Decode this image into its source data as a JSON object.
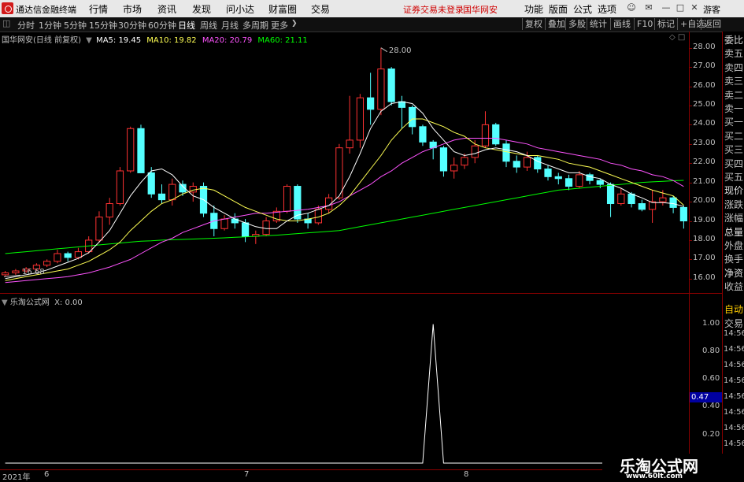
{
  "titlebar": {
    "app_name": "通达信金融终端",
    "menus": [
      "行情",
      "市场",
      "资讯",
      "发现",
      "问小达",
      "财富圈",
      "交易"
    ],
    "login_status": "证券交易未登录",
    "stock_name": "国华网安",
    "right_menus": [
      "功能",
      "版面",
      "公式",
      "选项"
    ],
    "guest": "游客"
  },
  "tabs": [
    "分时",
    "1分钟",
    "5分钟",
    "15分钟",
    "30分钟",
    "60分钟",
    "日线",
    "周线",
    "月线",
    "多周期",
    "更多"
  ],
  "tab_active": "日线",
  "right_buttons": [
    "复权",
    "叠加",
    "多股",
    "统计",
    "画线",
    "F10",
    "标记",
    "+自选",
    "返回"
  ],
  "main_legend": {
    "title": "国华网安(日线 前复权)",
    "ma5": "MA5: 19.45",
    "ma10": "MA10: 19.82",
    "ma20": "MA20: 20.79",
    "ma60": "MA60: 21.11"
  },
  "indicator_legend": {
    "title": "乐淘公式网",
    "x_value": "X: 0.00"
  },
  "high_label": "28.00",
  "low_label": "16.68",
  "price_axis": [
    "28.00",
    "27.00",
    "26.00",
    "25.00",
    "24.00",
    "23.00",
    "22.00",
    "21.00",
    "20.00",
    "19.00",
    "18.00",
    "17.00",
    "16.00"
  ],
  "ind_axis": [
    "1.00",
    "0.80",
    "0.60",
    "0.40",
    "0.20"
  ],
  "ind_axis_highlight": "0.47",
  "right_panel_top": [
    "委比",
    "卖五",
    "卖四",
    "卖三",
    "卖二",
    "卖一",
    "买一",
    "买二",
    "买三",
    "买四",
    "买五",
    "现价",
    "涨跌",
    "涨幅",
    "总量",
    "外盘",
    "换手",
    "净资",
    "收益"
  ],
  "right_panel_bottom": [
    "自动",
    "交易",
    "14:56",
    "14:56",
    "14:56",
    "14:56",
    "14:56",
    "14:56",
    "14:56",
    "14:56",
    "14:56"
  ],
  "date_labels": [
    "2021年",
    "6",
    "7",
    "8"
  ],
  "watermark": {
    "cn": "乐淘公式网",
    "url": "www.60lt.com"
  },
  "colors": {
    "up": "#ff3232",
    "down": "#54ffff",
    "ma5": "#ffffff",
    "ma10": "#ffff54",
    "ma20": "#ff54ff",
    "ma60": "#00ff00",
    "border": "#8b0000"
  },
  "chart_data": {
    "type": "candlestick",
    "dates_start": "2021-05",
    "ohlc": [
      [
        16.2,
        16.4,
        16.1,
        16.3
      ],
      [
        16.3,
        16.5,
        16.2,
        16.4
      ],
      [
        16.4,
        16.6,
        16.3,
        16.5
      ],
      [
        16.5,
        16.8,
        16.4,
        16.7
      ],
      [
        16.7,
        17.0,
        16.6,
        16.9
      ],
      [
        16.9,
        17.5,
        16.8,
        17.3
      ],
      [
        17.3,
        17.4,
        16.9,
        17.1
      ],
      [
        17.1,
        17.6,
        17.0,
        17.4
      ],
      [
        17.4,
        18.2,
        17.3,
        18.0
      ],
      [
        18.0,
        19.5,
        17.9,
        19.2
      ],
      [
        19.2,
        20.2,
        18.8,
        19.9
      ],
      [
        19.9,
        21.8,
        19.8,
        21.6
      ],
      [
        21.6,
        23.9,
        21.5,
        23.8
      ],
      [
        23.8,
        24.0,
        21.5,
        21.5
      ],
      [
        21.5,
        21.8,
        20.2,
        20.4
      ],
      [
        20.4,
        20.9,
        19.9,
        20.1
      ],
      [
        20.1,
        21.2,
        19.8,
        20.9
      ],
      [
        20.9,
        21.1,
        20.3,
        20.5
      ],
      [
        20.5,
        21.0,
        20.0,
        20.8
      ],
      [
        20.8,
        21.0,
        19.2,
        19.4
      ],
      [
        19.4,
        19.8,
        18.2,
        18.6
      ],
      [
        18.6,
        19.3,
        18.5,
        19.1
      ],
      [
        19.1,
        19.4,
        18.6,
        18.9
      ],
      [
        18.9,
        19.1,
        17.9,
        18.2
      ],
      [
        18.2,
        18.5,
        17.8,
        18.3
      ],
      [
        18.3,
        19.2,
        18.2,
        19.0
      ],
      [
        19.0,
        19.7,
        18.9,
        19.5
      ],
      [
        19.5,
        20.9,
        19.4,
        20.8
      ],
      [
        20.8,
        20.9,
        18.9,
        19.1
      ],
      [
        19.1,
        19.4,
        18.6,
        18.9
      ],
      [
        18.9,
        19.8,
        18.8,
        19.6
      ],
      [
        19.6,
        20.4,
        19.4,
        20.2
      ],
      [
        20.2,
        23.0,
        20.1,
        22.8
      ],
      [
        22.8,
        25.5,
        22.5,
        23.2
      ],
      [
        23.2,
        25.6,
        22.8,
        25.4
      ],
      [
        25.4,
        26.7,
        24.0,
        24.8
      ],
      [
        24.8,
        28.0,
        24.5,
        26.9
      ],
      [
        26.9,
        27.0,
        25.0,
        25.2
      ],
      [
        25.2,
        25.5,
        23.8,
        24.9
      ],
      [
        24.9,
        25.0,
        23.5,
        23.9
      ],
      [
        23.9,
        24.0,
        22.9,
        23.1
      ],
      [
        23.1,
        23.2,
        22.2,
        22.8
      ],
      [
        22.8,
        22.9,
        21.3,
        21.6
      ],
      [
        21.6,
        22.3,
        21.2,
        21.9
      ],
      [
        21.9,
        22.5,
        21.7,
        22.3
      ],
      [
        22.3,
        23.2,
        22.0,
        22.9
      ],
      [
        22.9,
        24.7,
        22.8,
        24.0
      ],
      [
        24.0,
        24.1,
        22.9,
        23.0
      ],
      [
        23.0,
        23.2,
        21.8,
        22.1
      ],
      [
        22.1,
        22.4,
        21.5,
        21.8
      ],
      [
        21.8,
        22.6,
        21.6,
        22.3
      ],
      [
        22.3,
        22.4,
        21.5,
        21.7
      ],
      [
        21.7,
        21.9,
        21.1,
        21.3
      ],
      [
        21.3,
        21.5,
        20.9,
        21.2
      ],
      [
        21.2,
        21.4,
        20.6,
        20.8
      ],
      [
        20.8,
        21.6,
        20.7,
        21.4
      ],
      [
        21.4,
        21.5,
        20.9,
        21.1
      ],
      [
        21.1,
        21.2,
        20.7,
        20.9
      ],
      [
        20.9,
        21.0,
        19.2,
        19.9
      ],
      [
        19.9,
        20.7,
        19.8,
        20.4
      ],
      [
        20.4,
        20.5,
        19.7,
        19.9
      ],
      [
        19.9,
        20.1,
        19.5,
        19.6
      ],
      [
        19.6,
        20.6,
        18.9,
        20.0
      ],
      [
        20.0,
        20.6,
        19.8,
        20.2
      ],
      [
        20.2,
        20.3,
        19.4,
        19.7
      ],
      [
        19.7,
        19.8,
        18.6,
        19.0
      ]
    ],
    "ma5": [
      16.0,
      16.1,
      16.2,
      16.3,
      16.45,
      16.65,
      16.85,
      17.05,
      17.35,
      17.9,
      18.5,
      19.4,
      20.3,
      21.0,
      21.6,
      21.7,
      21.4,
      20.8,
      20.3,
      20.1,
      19.7,
      19.4,
      19.1,
      18.9,
      18.7,
      18.6,
      18.6,
      19.0,
      19.3,
      19.4,
      19.6,
      19.8,
      20.3,
      21.3,
      22.5,
      23.8,
      24.7,
      25.1,
      25.2,
      25.1,
      24.6,
      23.8,
      23.2,
      22.6,
      22.4,
      22.5,
      22.7,
      22.8,
      22.7,
      22.6,
      22.4,
      22.1,
      21.9,
      21.7,
      21.5,
      21.5,
      21.3,
      21.2,
      20.9,
      20.7,
      20.4,
      20.2,
      19.95,
      19.95,
      19.9,
      19.75
    ],
    "ma10": [
      15.9,
      16.0,
      16.1,
      16.2,
      16.3,
      16.4,
      16.5,
      16.7,
      16.9,
      17.2,
      17.5,
      17.9,
      18.5,
      19.0,
      19.5,
      19.9,
      20.1,
      20.4,
      20.6,
      20.7,
      20.6,
      20.3,
      20.0,
      19.7,
      19.5,
      19.3,
      19.1,
      19.0,
      19.0,
      19.1,
      19.2,
      19.4,
      19.8,
      20.3,
      21.0,
      21.7,
      22.4,
      23.2,
      23.8,
      24.3,
      24.3,
      24.1,
      23.9,
      23.6,
      23.4,
      23.0,
      22.8,
      22.7,
      22.6,
      22.5,
      22.4,
      22.4,
      22.3,
      22.2,
      22.0,
      21.9,
      21.8,
      21.6,
      21.4,
      21.2,
      21.0,
      20.8,
      20.6,
      20.45,
      20.3,
      19.82
    ],
    "ma20": [
      15.8,
      15.85,
      15.9,
      15.95,
      16.0,
      16.05,
      16.1,
      16.2,
      16.3,
      16.45,
      16.6,
      16.8,
      17.0,
      17.3,
      17.6,
      17.9,
      18.1,
      18.4,
      18.6,
      18.8,
      19.0,
      19.1,
      19.2,
      19.3,
      19.4,
      19.4,
      19.45,
      19.5,
      19.55,
      19.6,
      19.7,
      19.8,
      20.0,
      20.3,
      20.6,
      20.9,
      21.3,
      21.6,
      22.0,
      22.3,
      22.6,
      22.8,
      23.0,
      23.2,
      23.3,
      23.3,
      23.3,
      23.3,
      23.2,
      23.1,
      23.0,
      22.8,
      22.7,
      22.6,
      22.5,
      22.4,
      22.3,
      22.2,
      22.0,
      21.9,
      21.7,
      21.6,
      21.4,
      21.3,
      21.1,
      20.79
    ],
    "ma60": [
      17.3,
      17.35,
      17.4,
      17.45,
      17.5,
      17.55,
      17.6,
      17.65,
      17.7,
      17.75,
      17.8,
      17.85,
      17.9,
      17.95,
      17.97,
      18.0,
      18.02,
      18.04,
      18.06,
      18.08,
      18.1,
      18.12,
      18.15,
      18.17,
      18.2,
      18.23,
      18.26,
      18.3,
      18.34,
      18.38,
      18.42,
      18.46,
      18.5,
      18.6,
      18.7,
      18.8,
      18.9,
      19.0,
      19.1,
      19.2,
      19.3,
      19.4,
      19.5,
      19.6,
      19.7,
      19.8,
      19.9,
      20.0,
      20.1,
      20.2,
      20.3,
      20.4,
      20.5,
      20.6,
      20.65,
      20.7,
      20.75,
      20.8,
      20.85,
      20.9,
      20.95,
      21.0,
      21.03,
      21.06,
      21.09,
      21.11
    ],
    "indicator_x": [
      0,
      0,
      0,
      0,
      0,
      0,
      0,
      0,
      0,
      0,
      0,
      0,
      0,
      0,
      0,
      0,
      0,
      0,
      0,
      0,
      0,
      0,
      0,
      0,
      0,
      0,
      0,
      0,
      0,
      0,
      0,
      0,
      0,
      0,
      0,
      0,
      0,
      0,
      0,
      0,
      0,
      1,
      0,
      0,
      0,
      0,
      0,
      0,
      0,
      0,
      0,
      0,
      0,
      0,
      0,
      0,
      0,
      0,
      0,
      0,
      0,
      0,
      0,
      0,
      0,
      0
    ],
    "ylim": [
      15.5,
      28.6
    ],
    "ind_ylim": [
      0,
      1.1
    ]
  }
}
